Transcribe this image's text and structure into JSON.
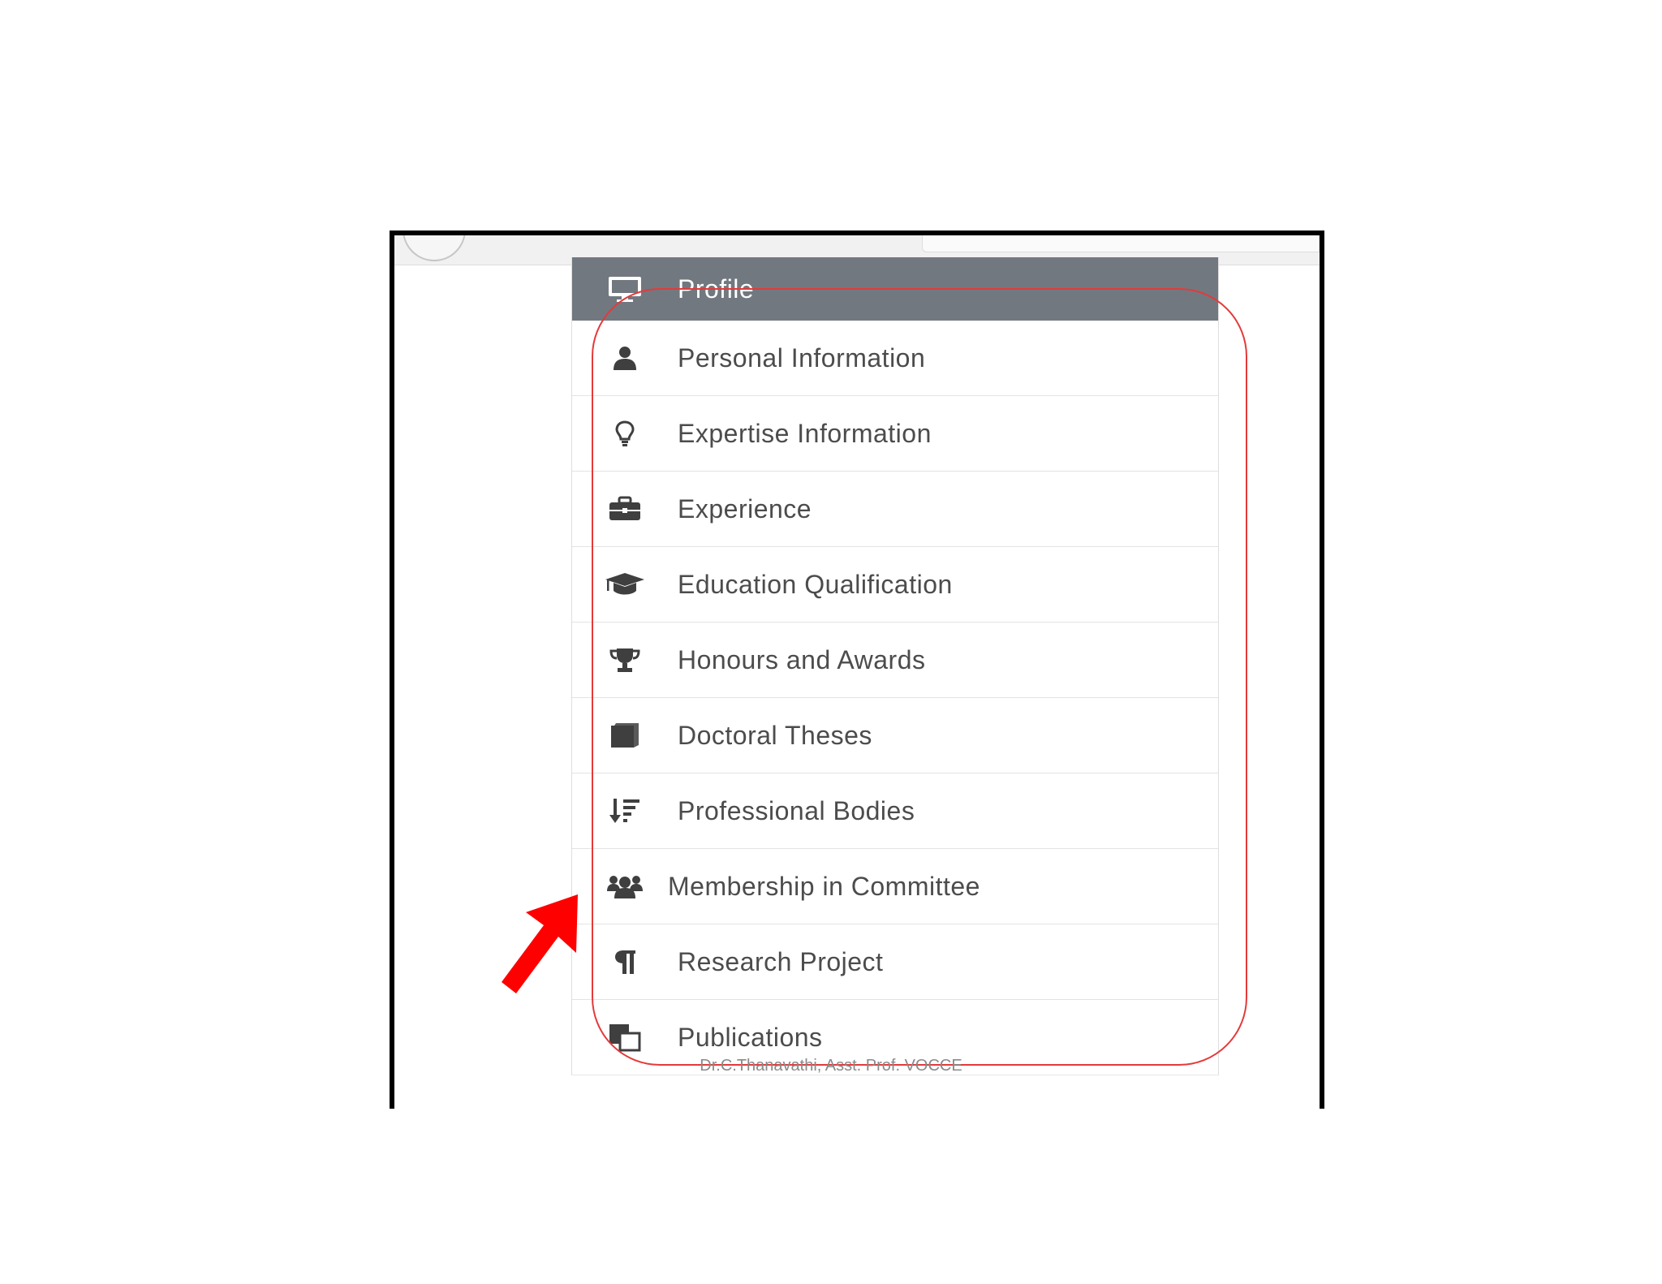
{
  "menu": {
    "header": {
      "label": "Profile",
      "icon": "monitor-icon"
    },
    "items": [
      {
        "label": "Personal Information",
        "icon": "user-icon"
      },
      {
        "label": "Expertise Information",
        "icon": "lightbulb-icon"
      },
      {
        "label": "Experience",
        "icon": "briefcase-icon"
      },
      {
        "label": "Education Qualification",
        "icon": "graduation-cap-icon"
      },
      {
        "label": "Honours and Awards",
        "icon": "trophy-icon"
      },
      {
        "label": "Doctoral Theses",
        "icon": "book-icon"
      },
      {
        "label": "Professional Bodies",
        "icon": "sort-amount-icon"
      },
      {
        "label": "Membership in Committee",
        "icon": "users-icon"
      },
      {
        "label": "Research Project",
        "icon": "paragraph-icon"
      },
      {
        "label": "Publications",
        "icon": "copy-icon"
      }
    ]
  },
  "annotation": {
    "highlight_color": "#e43a3a",
    "arrow_color": "#ff0000"
  },
  "footer": {
    "credit": "Dr.C.Thanavathi, Asst. Prof. VOCCE"
  }
}
